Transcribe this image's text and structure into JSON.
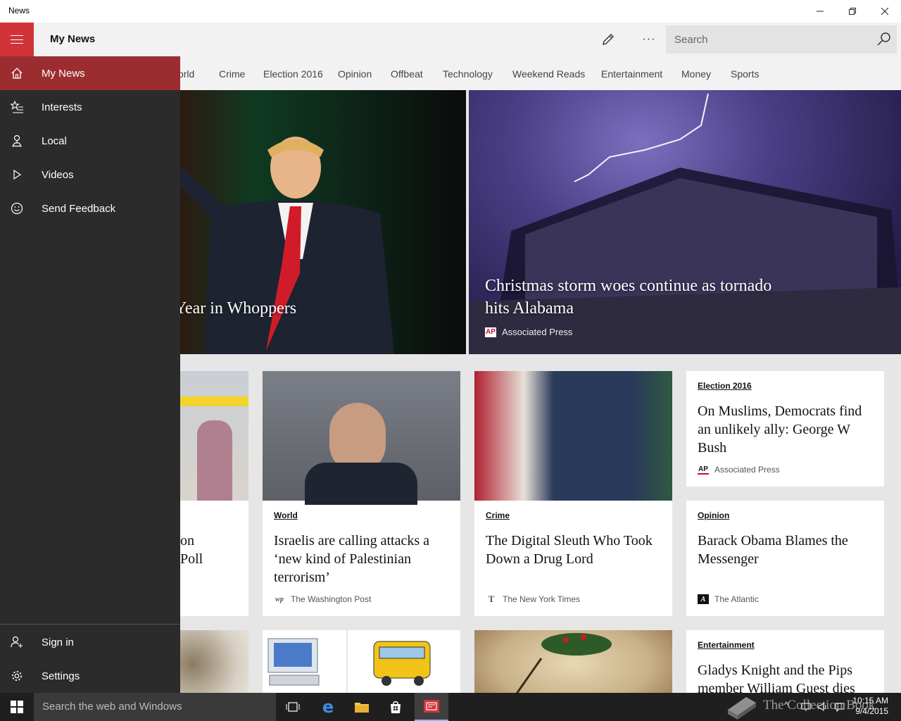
{
  "window": {
    "title": "News"
  },
  "header": {
    "title": "My News",
    "search_placeholder": "Search"
  },
  "categories": [
    "World",
    "Crime",
    "Election 2016",
    "Opinion",
    "Offbeat",
    "Technology",
    "Weekend Reads",
    "Entertainment",
    "Money",
    "Sports"
  ],
  "nav": {
    "items": [
      {
        "label": "My News",
        "icon": "home-icon"
      },
      {
        "label": "Interests",
        "icon": "star-list-icon"
      },
      {
        "label": "Local",
        "icon": "location-icon"
      },
      {
        "label": "Videos",
        "icon": "play-icon"
      },
      {
        "label": "Send Feedback",
        "icon": "smiley-icon"
      }
    ],
    "bottom": [
      {
        "label": "Sign in",
        "icon": "person-add-icon"
      },
      {
        "label": "Settings",
        "icon": "gear-icon"
      }
    ]
  },
  "heroes": [
    {
      "headline": "Year in Whoppers"
    },
    {
      "headline": "Christmas storm woes continue as tornado hits Alabama",
      "source": "Associated Press",
      "source_logo": "AP"
    }
  ],
  "cards": [
    {
      "headline_partial_1": "on",
      "headline_partial_2": "Poll"
    },
    {
      "category": "World",
      "headline": "Israelis are calling attacks a ‘new kind of Palestinian terrorism’",
      "source": "The Washington Post",
      "source_logo": "wp"
    },
    {
      "category": "Crime",
      "headline": "The Digital Sleuth Who Took Down a Drug Lord",
      "source": "The New York Times",
      "source_logo": "T"
    },
    {
      "category": "Election 2016",
      "headline": "On Muslims, Democrats find an unlikely ally: George W Bush",
      "source": "Associated Press",
      "source_logo": "AP"
    },
    {
      "category": "Opinion",
      "headline": "Barack Obama Blames the Messenger",
      "source": "The Atlantic",
      "source_logo": "A"
    },
    {
      "category": "Entertainment",
      "headline": "Gladys Knight and the Pips member William Guest dies"
    }
  ],
  "taskbar": {
    "search_placeholder": "Search the web and Windows",
    "time": "10:15 AM",
    "date": "9/4/2015"
  },
  "watermark": "The Collection Book",
  "colors": {
    "accent": "#d13438",
    "nav_active": "#9b2d30",
    "nav_bg": "#2b2b2b",
    "taskbar": "#1f1f1f"
  }
}
